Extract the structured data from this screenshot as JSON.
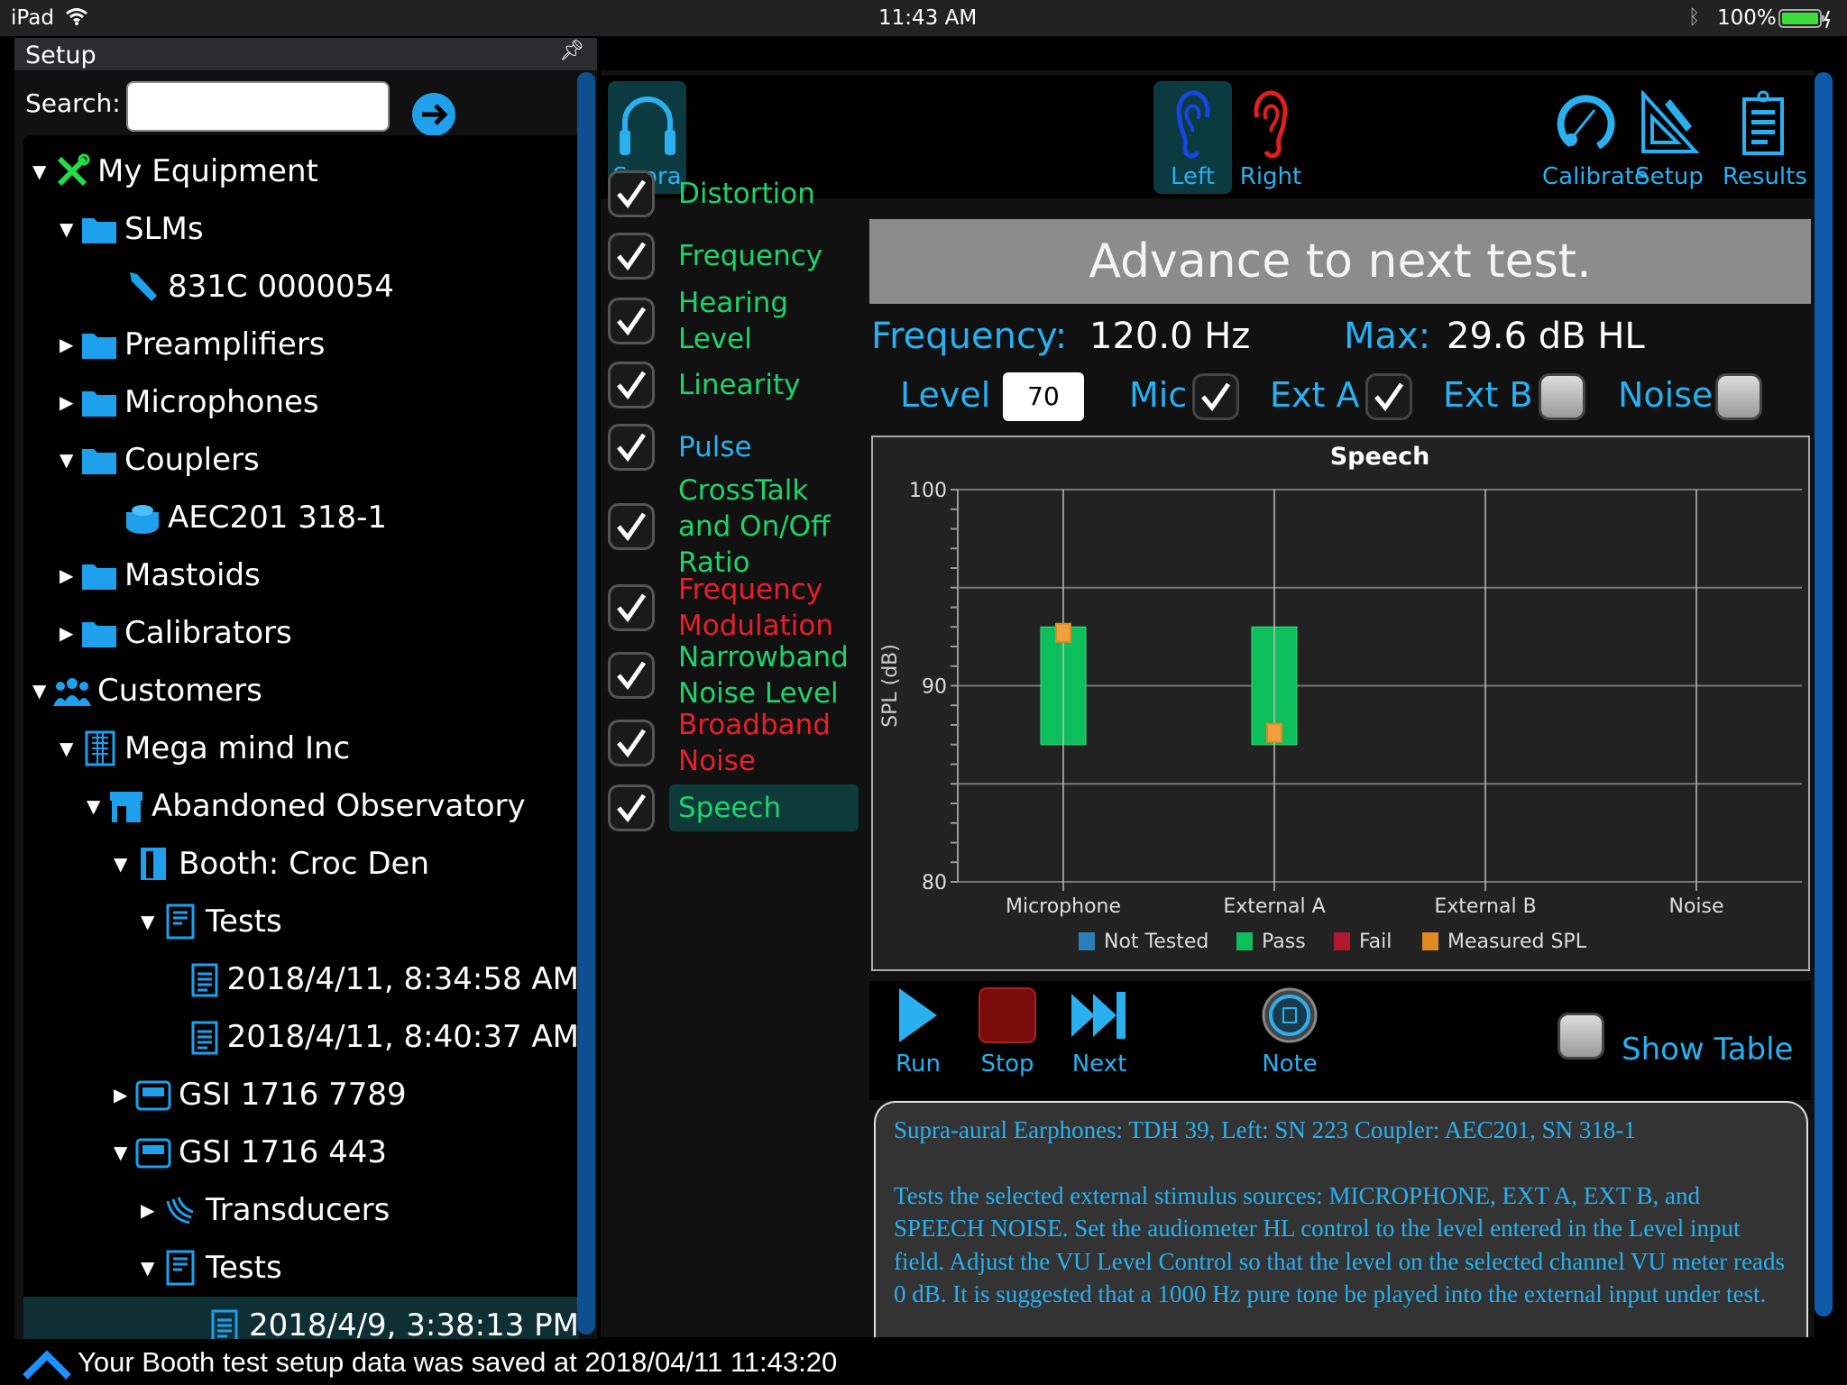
{
  "status_bar": {
    "device": "iPad",
    "time": "11:43 AM",
    "battery": "100%"
  },
  "setup_panel": {
    "title": "Setup",
    "search_label": "Search:",
    "search_value": "",
    "search_placeholder": ""
  },
  "tree": [
    {
      "label": "My Equipment",
      "level": 0,
      "state": "expanded",
      "icon": "tools-icon"
    },
    {
      "label": "SLMs",
      "level": 1,
      "state": "expanded",
      "icon": "folder-icon"
    },
    {
      "label": "831C 0000054",
      "level": 2,
      "state": "leaf",
      "icon": "sound-level-meter-icon"
    },
    {
      "label": "Preamplifiers",
      "level": 1,
      "state": "collapsed",
      "icon": "folder-icon"
    },
    {
      "label": "Microphones",
      "level": 1,
      "state": "collapsed",
      "icon": "folder-icon"
    },
    {
      "label": "Couplers",
      "level": 1,
      "state": "expanded",
      "icon": "folder-icon"
    },
    {
      "label": "AEC201 318-1",
      "level": 2,
      "state": "leaf",
      "icon": "coupler-icon"
    },
    {
      "label": "Mastoids",
      "level": 1,
      "state": "collapsed",
      "icon": "folder-icon"
    },
    {
      "label": "Calibrators",
      "level": 1,
      "state": "collapsed",
      "icon": "folder-icon"
    },
    {
      "label": "Customers",
      "level": 0,
      "state": "expanded",
      "icon": "people-icon"
    },
    {
      "label": "Mega mind Inc",
      "level": 1,
      "state": "expanded",
      "icon": "building-icon"
    },
    {
      "label": "Abandoned Observatory",
      "level": 2,
      "state": "expanded",
      "icon": "store-icon"
    },
    {
      "label": "Booth: Croc Den",
      "level": 3,
      "state": "expanded",
      "icon": "door-icon"
    },
    {
      "label": "Tests",
      "level": 4,
      "state": "expanded",
      "icon": "document-icon"
    },
    {
      "label": "2018/4/11, 8:34:58 AM",
      "level": 5,
      "state": "leaf",
      "icon": "clipboard-icon"
    },
    {
      "label": "2018/4/11, 8:40:37 AM",
      "level": 5,
      "state": "leaf",
      "icon": "clipboard-icon"
    },
    {
      "label": "GSI 1716 7789",
      "level": 3,
      "state": "collapsed",
      "icon": "audiometer-icon"
    },
    {
      "label": "GSI 1716 443",
      "level": 3,
      "state": "expanded",
      "icon": "audiometer-icon"
    },
    {
      "label": "Transducers",
      "level": 4,
      "state": "collapsed",
      "icon": "transducer-icon"
    },
    {
      "label": "Tests",
      "level": 4,
      "state": "expanded",
      "icon": "document-icon"
    },
    {
      "label": "2018/4/9, 3:38:13 PM",
      "level": 5,
      "state": "leaf",
      "icon": "clipboard-icon",
      "selected": true
    }
  ],
  "toolbar": {
    "supra": "Supra",
    "left": "Left",
    "right": "Right",
    "calibrate": "Calibrate",
    "setup": "Setup",
    "results": "Results"
  },
  "tests": [
    {
      "label": "Distortion",
      "color": "#1fd36a",
      "checked": true
    },
    {
      "label": "Frequency",
      "color": "#1fd36a",
      "checked": true
    },
    {
      "label": "Hearing Level",
      "color": "#1fd36a",
      "checked": true
    },
    {
      "label": "Linearity",
      "color": "#1fd36a",
      "checked": true
    },
    {
      "label": "Pulse",
      "color": "#2ab0f0",
      "checked": true
    },
    {
      "label": "CrossTalk and On/Off Ratio",
      "color": "#1fd36a",
      "checked": true
    },
    {
      "label": "Frequency Modulation",
      "color": "#e8202a",
      "checked": true
    },
    {
      "label": "Narrowband Noise Level",
      "color": "#1fd36a",
      "checked": true
    },
    {
      "label": "Broadband Noise",
      "color": "#e8202a",
      "checked": true
    },
    {
      "label": "Speech",
      "color": "#1fd36a",
      "checked": true,
      "selected": true
    }
  ],
  "banner": "Advance to next test.",
  "readout": {
    "freq_label": "Frequency:",
    "freq_value": "120.0 Hz",
    "max_label": "Max:",
    "max_value": "29.6 dB HL"
  },
  "inputs": {
    "level_label": "Level",
    "level_value": "70",
    "mic_label": "Mic",
    "mic_checked": true,
    "exta_label": "Ext A",
    "exta_checked": true,
    "extb_label": "Ext B",
    "extb_checked": false,
    "noise_label": "Noise",
    "noise_checked": false
  },
  "chart_data": {
    "type": "bar",
    "title": "Speech",
    "ylabel": "SPL (dB)",
    "xlabel": "",
    "ylim": [
      80,
      100
    ],
    "yticks": [
      "100",
      "90",
      "80"
    ],
    "categories": [
      "Microphone",
      "External A",
      "External B",
      "Noise"
    ],
    "pass_range": [
      {
        "low": 87,
        "high": 93
      },
      {
        "low": 87,
        "high": 93
      },
      null,
      null
    ],
    "measured_spl": [
      92.7,
      87.6,
      null,
      null
    ],
    "legend": [
      {
        "name": "Not Tested",
        "color": "#2a7fb8"
      },
      {
        "name": "Pass",
        "color": "#0dbf5a"
      },
      {
        "name": "Fail",
        "color": "#b01830"
      },
      {
        "name": "Measured SPL",
        "color": "#e08a20"
      }
    ],
    "legend_position": "bottom",
    "grid": true
  },
  "controls": {
    "run": "Run",
    "stop": "Stop",
    "next": "Next",
    "note": "Note",
    "show_table": "Show Table",
    "show_table_checked": false
  },
  "info": {
    "line1": "Supra-aural Earphones: TDH 39, Left: SN 223 Coupler: AEC201, SN 318-1",
    "para": "Tests the selected external stimulus sources: MICROPHONE, EXT A, EXT B, and SPEECH NOISE. Set the audiometer HL control to the level entered in the Level input field. Adjust the VU Level Control so that the level on the selected channel VU meter reads 0 dB. It is suggested that a 1000 Hz pure tone be played into the external input under test."
  },
  "bottom_status": "Your Booth test setup data was saved at 2018/04/11 11:43:20"
}
